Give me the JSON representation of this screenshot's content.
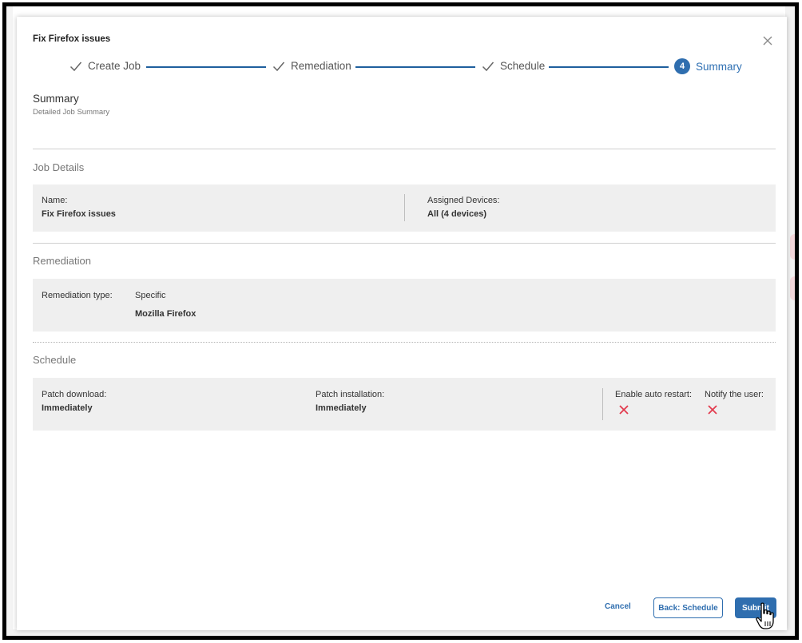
{
  "dialog": {
    "title": "Fix Firefox issues",
    "close_icon": "close-icon"
  },
  "stepper": {
    "steps": [
      {
        "label": "Create Job",
        "state": "done",
        "icon": "check-icon"
      },
      {
        "label": "Remediation",
        "state": "done",
        "icon": "check-icon"
      },
      {
        "label": "Schedule",
        "state": "done",
        "icon": "check-icon"
      },
      {
        "label": "Summary",
        "state": "active",
        "number": "4"
      }
    ]
  },
  "summary": {
    "title": "Summary",
    "subtitle": "Detailed Job Summary"
  },
  "job_details": {
    "title": "Job Details",
    "name_label": "Name:",
    "name_value": "Fix Firefox issues",
    "devices_label": "Assigned Devices:",
    "devices_value": "All (4 devices)"
  },
  "remediation": {
    "title": "Remediation",
    "type_label": "Remediation type:",
    "type_value": "Specific",
    "product": "Mozilla Firefox"
  },
  "schedule": {
    "title": "Schedule",
    "download_label": "Patch download:",
    "download_value": "Immediately",
    "install_label": "Patch installation:",
    "install_value": "Immediately",
    "auto_restart_label": "Enable auto restart:",
    "auto_restart_value": false,
    "notify_label": "Notify the user:",
    "notify_value": false
  },
  "footer": {
    "cancel_label": "Cancel",
    "back_label": "Back: Schedule",
    "submit_label": "Submit"
  },
  "colors": {
    "accent": "#2f6eaf",
    "panel_bg": "#efefef",
    "error": "#e23b4e"
  }
}
